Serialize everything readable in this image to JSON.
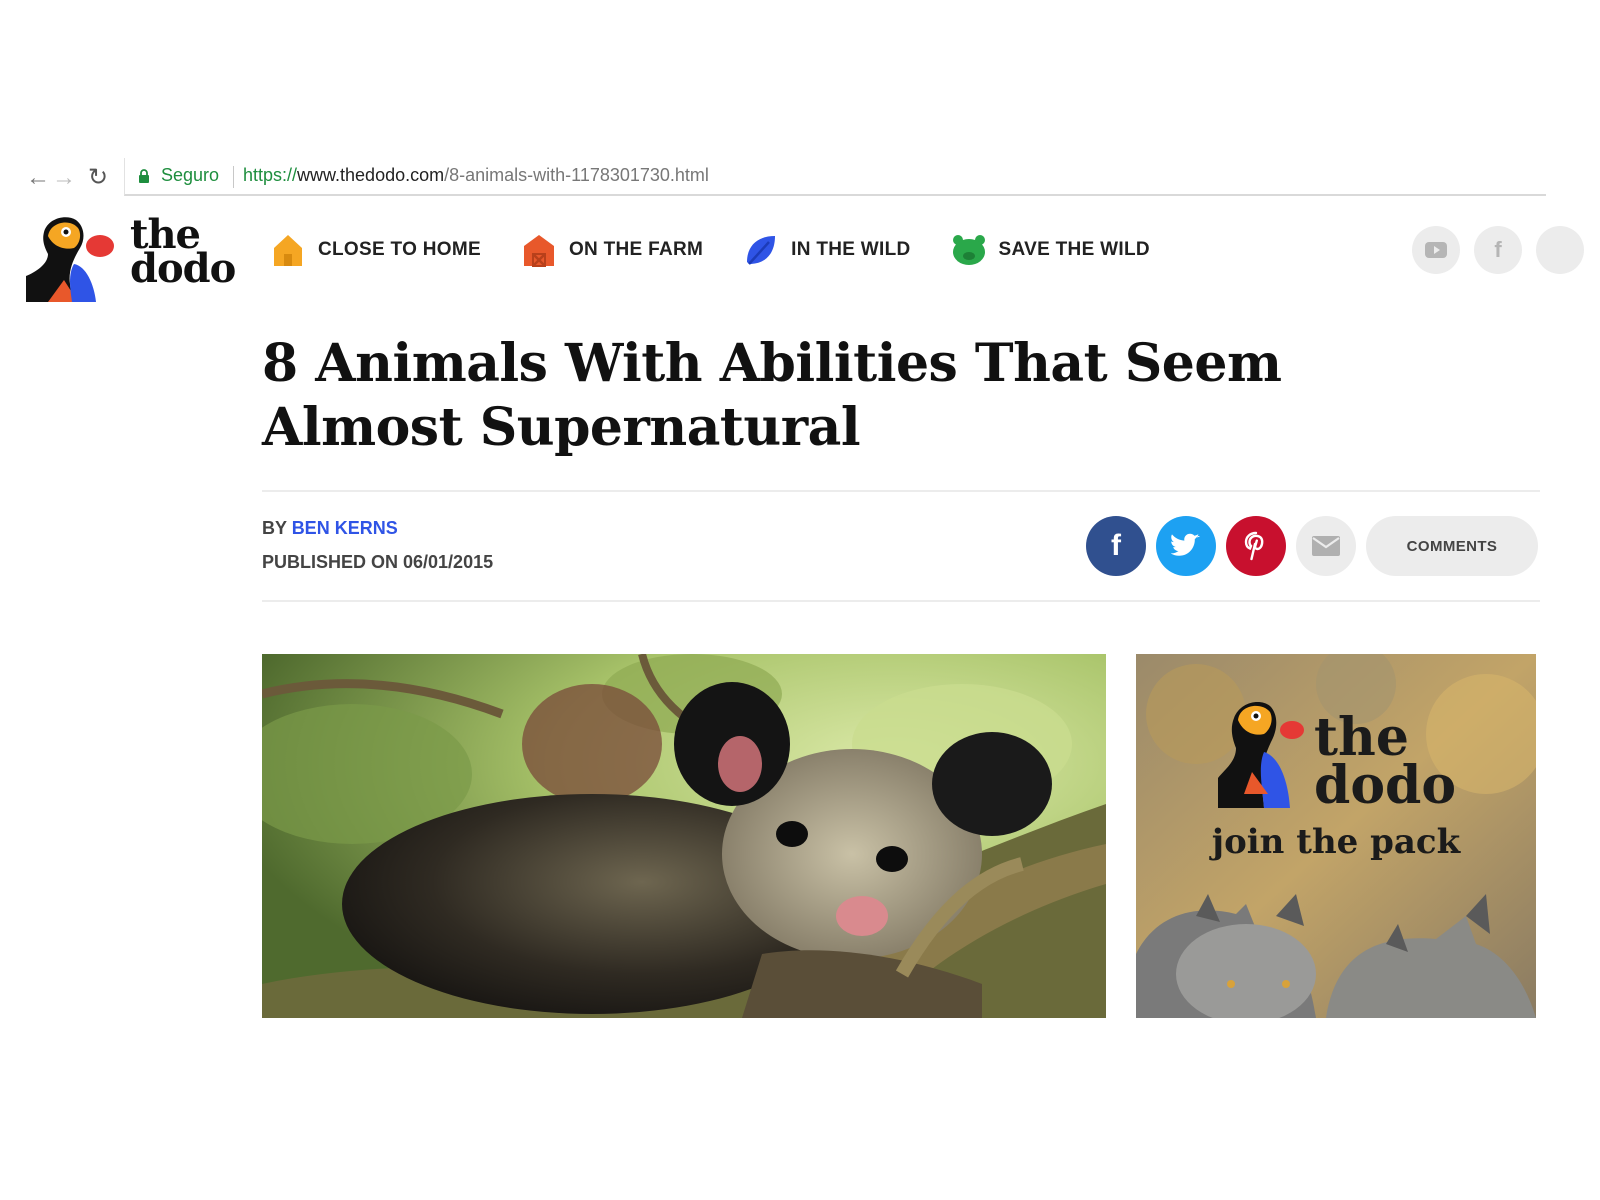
{
  "browser": {
    "secure_label": "Seguro",
    "url_scheme": "https://",
    "url_host": "www.thedodo.com",
    "url_path": "/8-animals-with-1178301730.html"
  },
  "site": {
    "logo_line1": "the",
    "logo_line2": "dodo"
  },
  "nav": {
    "items": [
      {
        "label": "CLOSE TO HOME",
        "icon": "house-icon",
        "color": "#f5a623"
      },
      {
        "label": "ON THE FARM",
        "icon": "barn-icon",
        "color": "#e8582b"
      },
      {
        "label": "IN THE WILD",
        "icon": "leaf-icon",
        "color": "#2f54e6"
      },
      {
        "label": "SAVE THE WILD",
        "icon": "bear-icon",
        "color": "#2aa84a"
      }
    ]
  },
  "header_social": {
    "youtube_icon": "youtube-icon",
    "facebook_glyph": "f"
  },
  "article": {
    "title": "8 Animals With Abilities That Seem Almost Supernatural",
    "by_prefix": "BY ",
    "author": "BEN KERNS",
    "published": "PUBLISHED ON 06/01/2015"
  },
  "share": {
    "facebook_glyph": "f",
    "comments_label": "COMMENTS"
  },
  "ad": {
    "logo_line1": "the",
    "logo_line2": "dodo",
    "tagline": "join the pack"
  }
}
